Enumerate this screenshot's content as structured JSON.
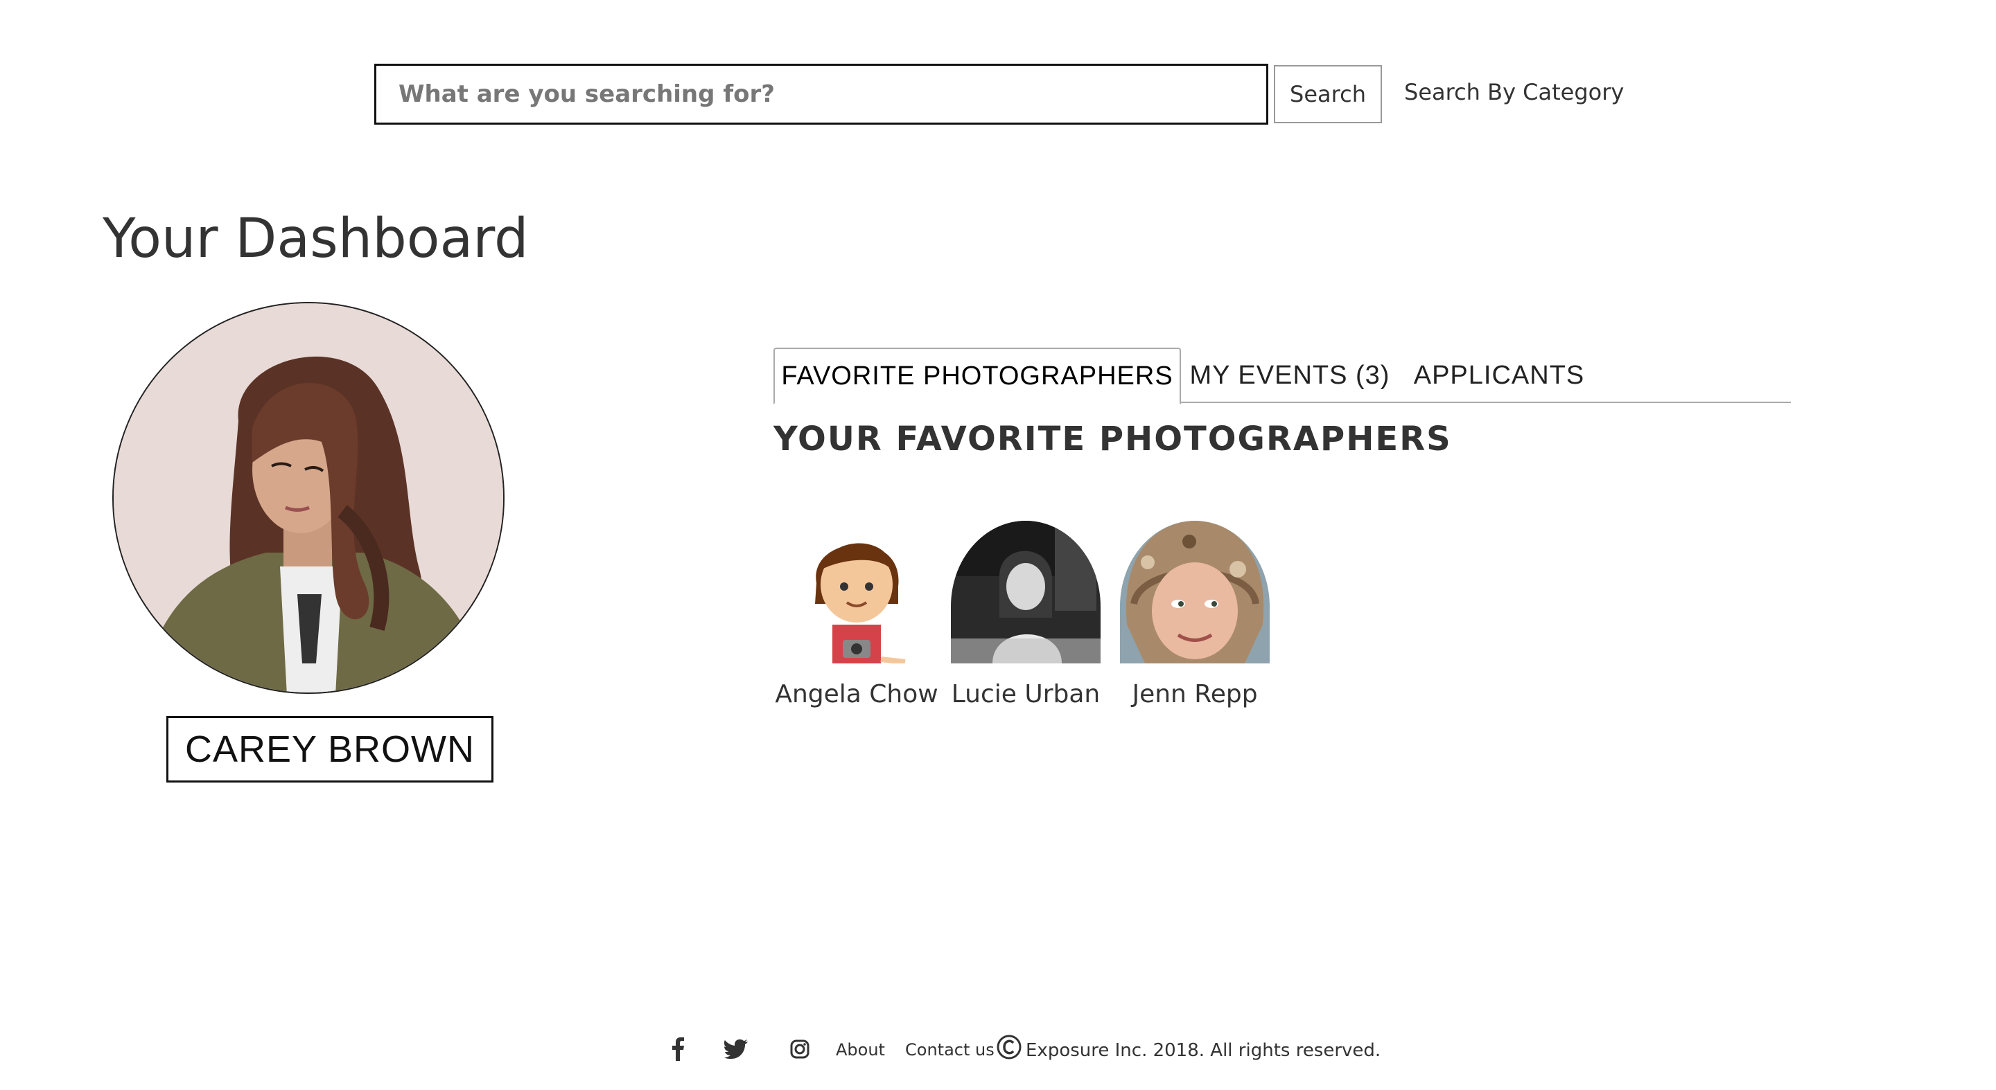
{
  "search": {
    "placeholder": "What are you searching for?",
    "button_label": "Search",
    "category_label": "Search By Category"
  },
  "page": {
    "title": "Your Dashboard"
  },
  "profile": {
    "name": "CAREY BROWN",
    "avatar_icon": "user-photo-avatar"
  },
  "tabs": [
    {
      "label": "FAVORITE PHOTOGRAPHERS",
      "active": true
    },
    {
      "label": "MY EVENTS (3)",
      "active": false
    },
    {
      "label": "APPLICANTS",
      "active": false
    }
  ],
  "section": {
    "heading": "YOUR FAVORITE PHOTOGRAPHERS"
  },
  "favorites": [
    {
      "name": "Angela Chow",
      "avatar_icon": "cartoon-photographer-avatar"
    },
    {
      "name": "Lucie Urban",
      "avatar_icon": "bw-portrait-avatar"
    },
    {
      "name": "Jenn Repp",
      "avatar_icon": "fur-hat-portrait-avatar"
    }
  ],
  "footer": {
    "social": [
      "facebook-icon",
      "twitter-icon",
      "instagram-icon"
    ],
    "about": "About",
    "contact": "Contact us",
    "copyright": "Exposure Inc. 2018. All rights reserved."
  }
}
